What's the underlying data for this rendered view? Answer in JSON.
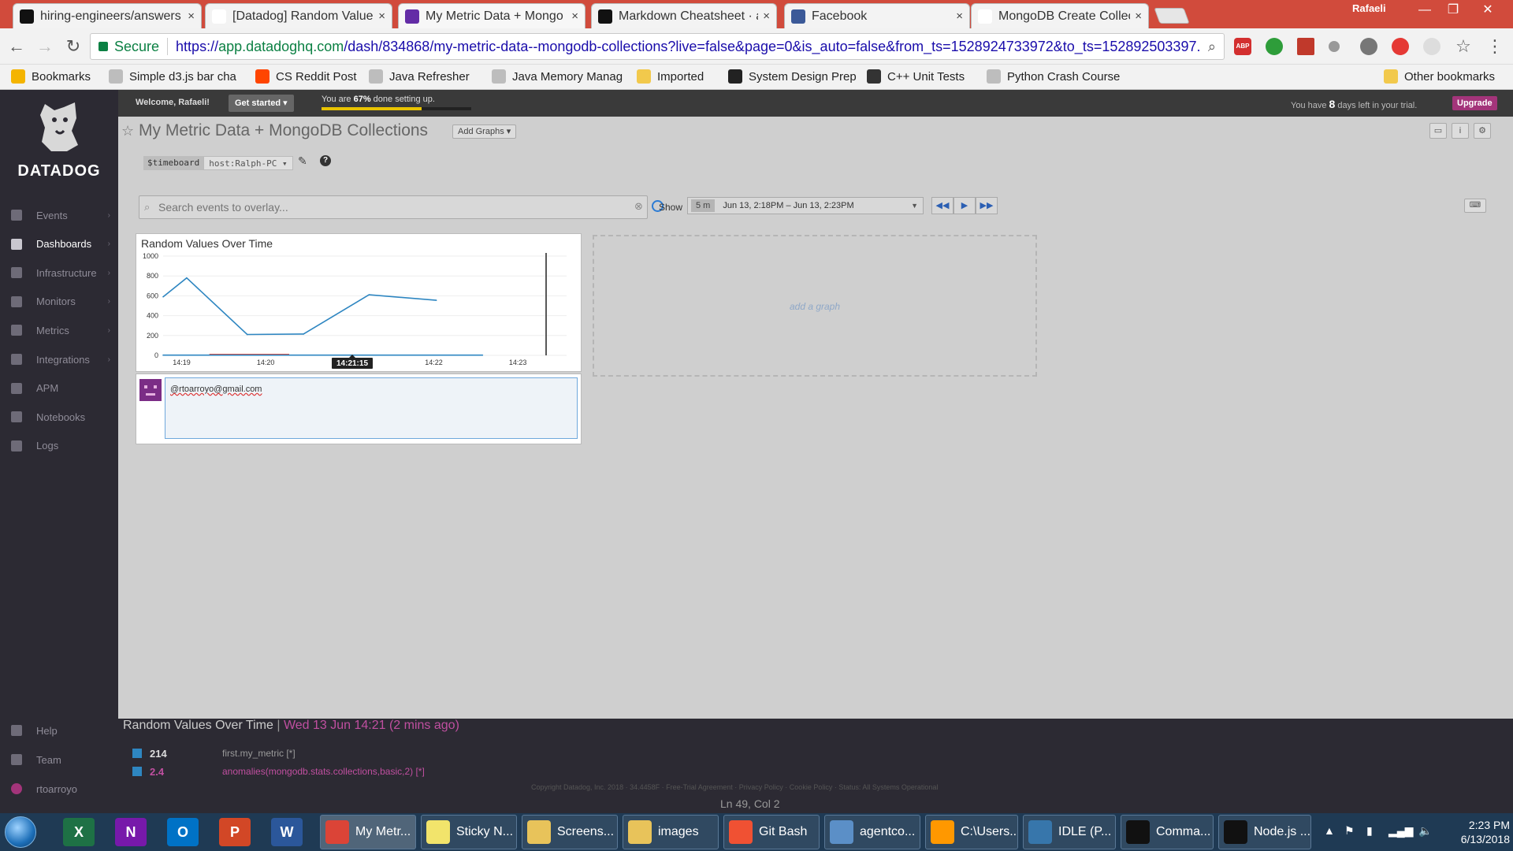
{
  "browser": {
    "tabs": [
      {
        "label": "hiring-engineers/answers",
        "icon": "github-icon",
        "active": false
      },
      {
        "label": "[Datadog] Random Value",
        "icon": "gmail-icon",
        "active": false
      },
      {
        "label": "My Metric Data + Mongo",
        "icon": "datadog-icon",
        "active": true
      },
      {
        "label": "Markdown Cheatsheet · a",
        "icon": "github-icon",
        "active": false
      },
      {
        "label": "Facebook",
        "icon": "facebook-icon",
        "active": false
      },
      {
        "label": "MongoDB Create Collecti",
        "icon": "mongodb-icon",
        "active": false
      }
    ],
    "close_glyph": "×",
    "profile": "Rafaeli",
    "secure_label": "Secure",
    "url_scheme": "https://",
    "url_host": "app.datadoghq.com",
    "url_path": "/dash/834868/my-metric-data--mongodb-collections?live=false&page=0&is_auto=false&from_ts=1528924733972&to_ts=152892503397..."
  },
  "bookmarks": [
    {
      "label": "Bookmarks",
      "icon": "star-icon"
    },
    {
      "label": "Simple d3.js bar cha",
      "icon": "page-icon"
    },
    {
      "label": "CS Reddit Post",
      "icon": "reddit-icon"
    },
    {
      "label": "Java Refresher",
      "icon": "page-icon"
    },
    {
      "label": "Java Memory Manag",
      "icon": "page-icon"
    },
    {
      "label": "Imported",
      "icon": "folder-icon"
    },
    {
      "label": "System Design Prep",
      "icon": "github-icon"
    },
    {
      "label": "C++ Unit Tests",
      "icon": "linux-icon"
    },
    {
      "label": "Python Crash Course",
      "icon": "page-icon"
    },
    {
      "label": "Other bookmarks",
      "icon": "folder-icon"
    }
  ],
  "app": {
    "brand": "DATADOG",
    "nav": [
      {
        "label": "Events",
        "icon": "events-icon",
        "active": false
      },
      {
        "label": "Dashboards",
        "icon": "dashboards-icon",
        "active": true
      },
      {
        "label": "Infrastructure",
        "icon": "infrastructure-icon",
        "active": false
      },
      {
        "label": "Monitors",
        "icon": "monitors-icon",
        "active": false
      },
      {
        "label": "Metrics",
        "icon": "metrics-icon",
        "active": false
      },
      {
        "label": "Integrations",
        "icon": "integrations-icon",
        "active": false
      },
      {
        "label": "APM",
        "icon": "apm-icon",
        "active": false
      },
      {
        "label": "Notebooks",
        "icon": "notebooks-icon",
        "active": false
      },
      {
        "label": "Logs",
        "icon": "logs-icon",
        "active": false
      }
    ],
    "bottom_nav": [
      {
        "label": "Help",
        "icon": "help-icon"
      },
      {
        "label": "Team",
        "icon": "team-icon"
      },
      {
        "label": "rtoarroyo",
        "icon": "user-avatar-icon"
      }
    ],
    "welcome": "Welcome, Rafaeli!",
    "get_started": "Get started ▾",
    "setup_prefix": "You are ",
    "setup_percent": "67%",
    "setup_suffix": " done setting up.",
    "setup_progress": 0.67,
    "trial_prefix": "You have ",
    "trial_days": "8",
    "trial_suffix": " days left in your trial.",
    "upgrade": "Upgrade",
    "colors": {
      "sidebar": "#2c2a33",
      "accent": "#a3347a",
      "line": "#2e86c1"
    }
  },
  "dashboard": {
    "title": "My Metric Data + MongoDB Collections",
    "add_graphs": "Add Graphs ▾",
    "template_var_name": "$timeboard",
    "template_var_value": "host:Ralph-PC ▾",
    "search_placeholder": "Search events to overlay...",
    "show_label": "Show",
    "time_span": "5 m",
    "time_range": "Jun 13, 2:18PM – Jun 13, 2:23PM",
    "add_graph_label": "add a graph",
    "widget_title": "Random Values Over Time",
    "annotation_text": "@rtoarroyo@gmail.com"
  },
  "chart_data": {
    "type": "line",
    "title": "Random Values Over Time",
    "xlabel": "",
    "ylabel": "",
    "ylim": [
      0,
      1000
    ],
    "yticks": [
      "1000",
      "800",
      "600",
      "400",
      "200",
      "0"
    ],
    "xticks": [
      "14:19",
      "14:20",
      "14:21",
      "14:22",
      "14:23"
    ],
    "cursor_label": "14:21:15",
    "series": [
      {
        "name": "first.my_metric",
        "color": "#2e86c1",
        "x": [
          0.0,
          0.28,
          1.0,
          1.67,
          2.45,
          3.25
        ],
        "y": [
          590,
          780,
          210,
          215,
          610,
          555
        ]
      },
      {
        "name": "anomalies(mongodb.stats.collections,basic,2)",
        "color": "#2e86c1",
        "x": [
          0.0,
          3.8
        ],
        "y": [
          2.4,
          2.4
        ]
      }
    ],
    "anomaly_band": {
      "color": "#e74c3c",
      "x": [
        0.55,
        1.5
      ]
    },
    "cursor_x": 2.25
  },
  "legend": {
    "title": "Random Values Over Time",
    "separator": "|",
    "timestamp": "Wed 13 Jun 14:21 (2 mins ago)",
    "rows": [
      {
        "value": "214",
        "name": "first.my_metric [*]",
        "value_color": "#dddddd",
        "name_color": "#9a9a9a"
      },
      {
        "value": "2.4",
        "name": "anomalies(mongodb.stats.collections,basic,2) [*]",
        "value_color": "#c04fa0",
        "name_color": "#c04fa0"
      }
    ],
    "copyright": "Copyright Datadog, Inc. 2018 · 34.4458F · Free-Trial Agreement · Privacy Policy · Cookie Policy · Status: All Systems Operational",
    "ln_col": "Ln 49, Col 2"
  },
  "taskbar": {
    "pinned": [
      {
        "name": "excel-icon",
        "glyph": "X",
        "color": "#1e7145"
      },
      {
        "name": "onenote-icon",
        "glyph": "N",
        "color": "#7719aa"
      },
      {
        "name": "outlook-icon",
        "glyph": "O",
        "color": "#0072c6"
      },
      {
        "name": "powerpoint-icon",
        "glyph": "P",
        "color": "#d24726"
      },
      {
        "name": "word-icon",
        "glyph": "W",
        "color": "#2b579a"
      }
    ],
    "windows": [
      {
        "label": "My Metr...",
        "icon": "chrome-icon",
        "color": "#db4437",
        "active": true
      },
      {
        "label": "Sticky N...",
        "icon": "sticky-notes-icon",
        "color": "#f2e46b",
        "active": false
      },
      {
        "label": "Screens...",
        "icon": "folder-icon",
        "color": "#e8c35a",
        "active": false
      },
      {
        "label": "images",
        "icon": "folder-icon",
        "color": "#e8c35a",
        "active": false
      },
      {
        "label": "Git Bash",
        "icon": "git-icon",
        "color": "#f05133",
        "active": false
      },
      {
        "label": "agentco...",
        "icon": "image-viewer-icon",
        "color": "#5b8fc7",
        "active": false
      },
      {
        "label": "C:\\Users...",
        "icon": "sublime-icon",
        "color": "#ff9800",
        "active": false
      },
      {
        "label": "IDLE (P...",
        "icon": "python-icon",
        "color": "#3776ab",
        "active": false
      },
      {
        "label": "Comma...",
        "icon": "terminal-icon",
        "color": "#111111",
        "active": false
      },
      {
        "label": "Node.js ...",
        "icon": "terminal-icon",
        "color": "#111111",
        "active": false
      }
    ],
    "time": "2:23 PM",
    "date": "6/13/2018"
  }
}
